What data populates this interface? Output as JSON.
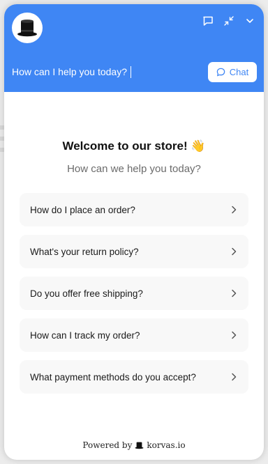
{
  "header": {
    "avatar_icon": "top-hat-icon",
    "icons": [
      "chat-bubble-icon",
      "collapse-arrows-icon",
      "chevron-down-icon"
    ],
    "input_text": "How can I help you today?",
    "chat_button_label": "Chat",
    "accent_color": "#3f86f4"
  },
  "main": {
    "welcome": "Welcome to our store! 👋",
    "subtitle": "How can we help you today?",
    "faqs": [
      {
        "label": "How do I place an order?"
      },
      {
        "label": "What's your return policy?"
      },
      {
        "label": "Do you offer free shipping?"
      },
      {
        "label": "How can I track my order?"
      },
      {
        "label": "What payment methods do you accept?"
      }
    ]
  },
  "footer": {
    "powered_by": "Powered by",
    "brand": "korvas.io"
  }
}
